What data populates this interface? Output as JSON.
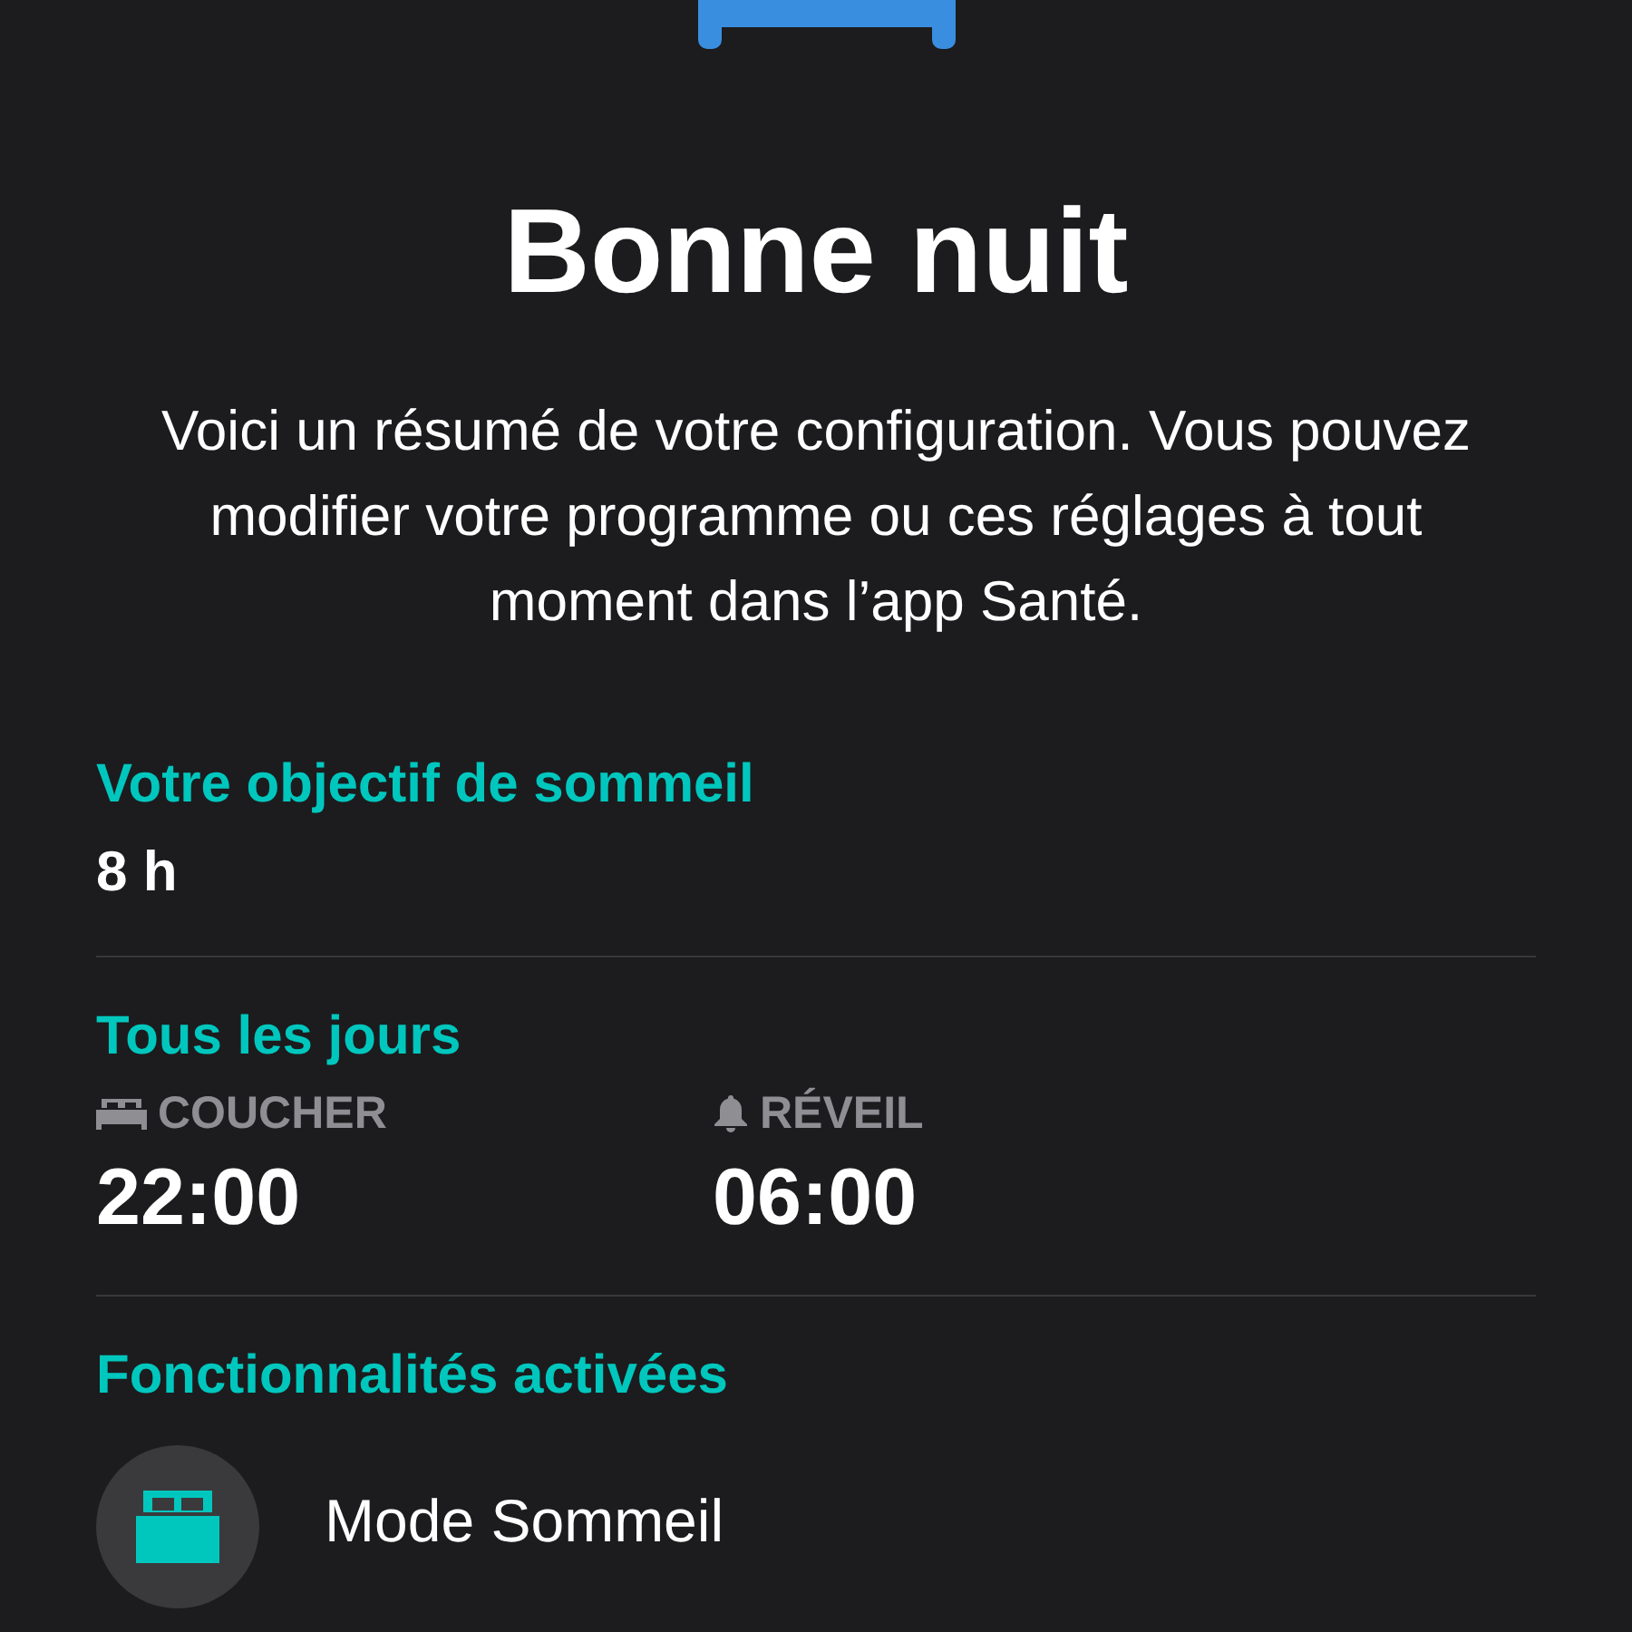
{
  "title": "Bonne nuit",
  "description": "Voici un résumé de votre configuration. Vous pouvez modifier votre programme ou ces réglages à tout moment dans l’app Santé.",
  "goal": {
    "heading": "Votre objectif de sommeil",
    "value": "8 h"
  },
  "schedule": {
    "heading": "Tous les jours",
    "items": [
      {
        "kind": "bedtime",
        "label": "COUCHER",
        "time": "22:00"
      },
      {
        "kind": "wake",
        "label": "RÉVEIL",
        "time": "06:00"
      }
    ]
  },
  "features": {
    "heading": "Fonctionnalités activées",
    "items": [
      {
        "kind": "sleep_mode",
        "label": "Mode Sommeil"
      }
    ]
  }
}
